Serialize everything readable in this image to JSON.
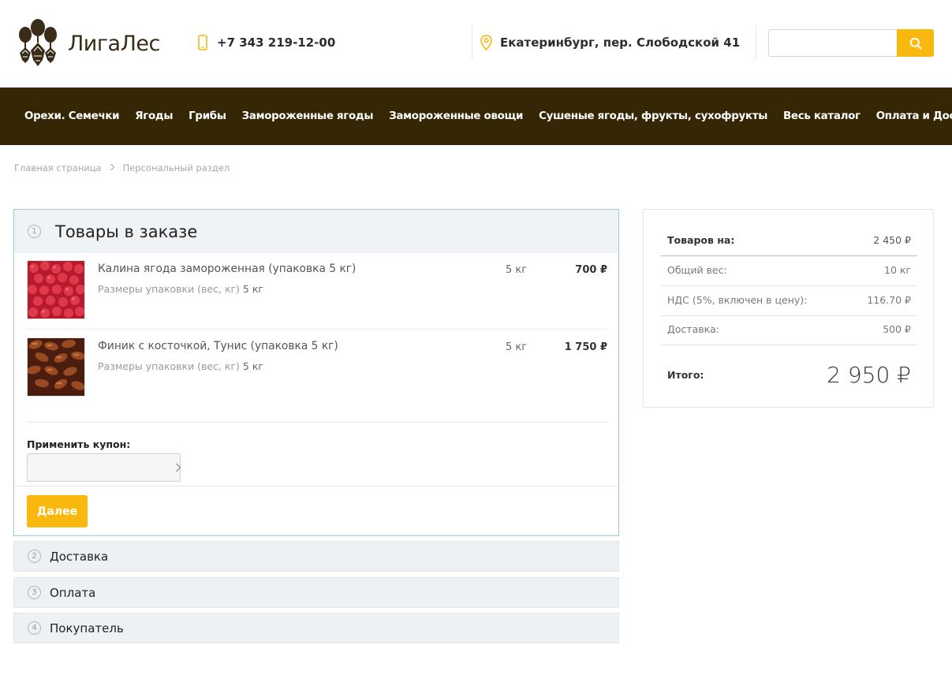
{
  "header": {
    "logo_text": "ЛигаЛес",
    "phone": "+7 343 219-12-00",
    "address": "Екатеринбург, пер. Слободской 41",
    "search_placeholder": ""
  },
  "nav": {
    "items": [
      "Орехи. Семечки",
      "Ягоды",
      "Грибы",
      "Замороженные ягоды",
      "Замороженные овощи",
      "Сушеные ягоды, фрукты, сухофрукты",
      "Весь каталог",
      "Оплата и Доставка"
    ]
  },
  "breadcrumb": {
    "home": "Главная страница",
    "current": "Персональный раздел"
  },
  "order": {
    "step_number": "1",
    "title": "Товары в заказе",
    "items": [
      {
        "name": "Калина ягода замороженная (упаковка 5 кг)",
        "prop_label": "Размеры упаковки (вес, кг)",
        "prop_value": "5 кг",
        "qty": "5 кг",
        "price": "700 ₽"
      },
      {
        "name": "Финик с косточкой, Тунис (упаковка 5 кг)",
        "prop_label": "Размеры упаковки (вес, кг)",
        "prop_value": "5 кг",
        "qty": "5 кг",
        "price": "1 750 ₽"
      }
    ],
    "coupon_label": "Применить купон:",
    "coupon_value": "",
    "next_label": "Далее"
  },
  "steps": [
    {
      "number": "2",
      "title": "Доставка"
    },
    {
      "number": "3",
      "title": "Оплата"
    },
    {
      "number": "4",
      "title": "Покупатель"
    }
  ],
  "summary": {
    "goods_label": "Товаров на:",
    "goods_value": "2 450 ₽",
    "weight_label": "Общий вес:",
    "weight_value": "10 кг",
    "vat_label": "НДС (5%, включен в цену):",
    "vat_value": "116.70 ₽",
    "delivery_label": "Доставка:",
    "delivery_value": "500 ₽",
    "total_label": "Итого:",
    "total_value": "2 950 ₽"
  },
  "colors": {
    "accent": "#f9b80d",
    "nav_bg": "#352706",
    "order_border": "#9ccbd8"
  }
}
